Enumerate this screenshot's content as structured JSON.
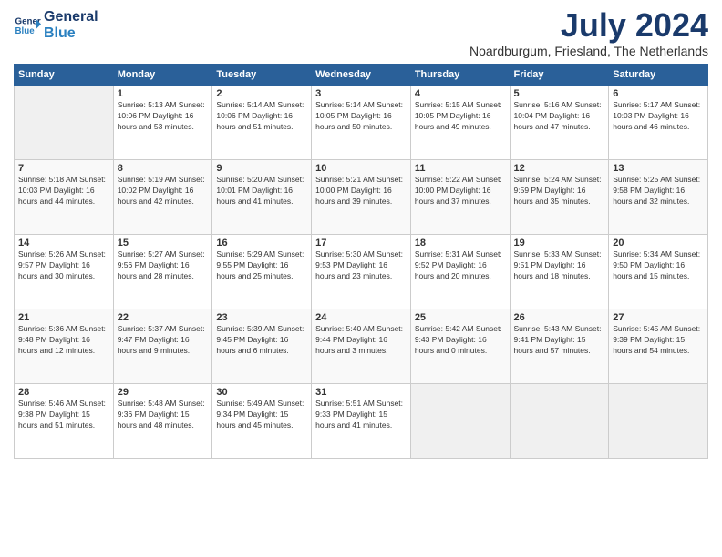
{
  "logo": {
    "line1": "General",
    "line2": "Blue"
  },
  "title": "July 2024",
  "location": "Noardburgum, Friesland, The Netherlands",
  "headers": [
    "Sunday",
    "Monday",
    "Tuesday",
    "Wednesday",
    "Thursday",
    "Friday",
    "Saturday"
  ],
  "weeks": [
    [
      {
        "day": "",
        "info": ""
      },
      {
        "day": "1",
        "info": "Sunrise: 5:13 AM\nSunset: 10:06 PM\nDaylight: 16 hours\nand 53 minutes."
      },
      {
        "day": "2",
        "info": "Sunrise: 5:14 AM\nSunset: 10:06 PM\nDaylight: 16 hours\nand 51 minutes."
      },
      {
        "day": "3",
        "info": "Sunrise: 5:14 AM\nSunset: 10:05 PM\nDaylight: 16 hours\nand 50 minutes."
      },
      {
        "day": "4",
        "info": "Sunrise: 5:15 AM\nSunset: 10:05 PM\nDaylight: 16 hours\nand 49 minutes."
      },
      {
        "day": "5",
        "info": "Sunrise: 5:16 AM\nSunset: 10:04 PM\nDaylight: 16 hours\nand 47 minutes."
      },
      {
        "day": "6",
        "info": "Sunrise: 5:17 AM\nSunset: 10:03 PM\nDaylight: 16 hours\nand 46 minutes."
      }
    ],
    [
      {
        "day": "7",
        "info": "Sunrise: 5:18 AM\nSunset: 10:03 PM\nDaylight: 16 hours\nand 44 minutes."
      },
      {
        "day": "8",
        "info": "Sunrise: 5:19 AM\nSunset: 10:02 PM\nDaylight: 16 hours\nand 42 minutes."
      },
      {
        "day": "9",
        "info": "Sunrise: 5:20 AM\nSunset: 10:01 PM\nDaylight: 16 hours\nand 41 minutes."
      },
      {
        "day": "10",
        "info": "Sunrise: 5:21 AM\nSunset: 10:00 PM\nDaylight: 16 hours\nand 39 minutes."
      },
      {
        "day": "11",
        "info": "Sunrise: 5:22 AM\nSunset: 10:00 PM\nDaylight: 16 hours\nand 37 minutes."
      },
      {
        "day": "12",
        "info": "Sunrise: 5:24 AM\nSunset: 9:59 PM\nDaylight: 16 hours\nand 35 minutes."
      },
      {
        "day": "13",
        "info": "Sunrise: 5:25 AM\nSunset: 9:58 PM\nDaylight: 16 hours\nand 32 minutes."
      }
    ],
    [
      {
        "day": "14",
        "info": "Sunrise: 5:26 AM\nSunset: 9:57 PM\nDaylight: 16 hours\nand 30 minutes."
      },
      {
        "day": "15",
        "info": "Sunrise: 5:27 AM\nSunset: 9:56 PM\nDaylight: 16 hours\nand 28 minutes."
      },
      {
        "day": "16",
        "info": "Sunrise: 5:29 AM\nSunset: 9:55 PM\nDaylight: 16 hours\nand 25 minutes."
      },
      {
        "day": "17",
        "info": "Sunrise: 5:30 AM\nSunset: 9:53 PM\nDaylight: 16 hours\nand 23 minutes."
      },
      {
        "day": "18",
        "info": "Sunrise: 5:31 AM\nSunset: 9:52 PM\nDaylight: 16 hours\nand 20 minutes."
      },
      {
        "day": "19",
        "info": "Sunrise: 5:33 AM\nSunset: 9:51 PM\nDaylight: 16 hours\nand 18 minutes."
      },
      {
        "day": "20",
        "info": "Sunrise: 5:34 AM\nSunset: 9:50 PM\nDaylight: 16 hours\nand 15 minutes."
      }
    ],
    [
      {
        "day": "21",
        "info": "Sunrise: 5:36 AM\nSunset: 9:48 PM\nDaylight: 16 hours\nand 12 minutes."
      },
      {
        "day": "22",
        "info": "Sunrise: 5:37 AM\nSunset: 9:47 PM\nDaylight: 16 hours\nand 9 minutes."
      },
      {
        "day": "23",
        "info": "Sunrise: 5:39 AM\nSunset: 9:45 PM\nDaylight: 16 hours\nand 6 minutes."
      },
      {
        "day": "24",
        "info": "Sunrise: 5:40 AM\nSunset: 9:44 PM\nDaylight: 16 hours\nand 3 minutes."
      },
      {
        "day": "25",
        "info": "Sunrise: 5:42 AM\nSunset: 9:43 PM\nDaylight: 16 hours\nand 0 minutes."
      },
      {
        "day": "26",
        "info": "Sunrise: 5:43 AM\nSunset: 9:41 PM\nDaylight: 15 hours\nand 57 minutes."
      },
      {
        "day": "27",
        "info": "Sunrise: 5:45 AM\nSunset: 9:39 PM\nDaylight: 15 hours\nand 54 minutes."
      }
    ],
    [
      {
        "day": "28",
        "info": "Sunrise: 5:46 AM\nSunset: 9:38 PM\nDaylight: 15 hours\nand 51 minutes."
      },
      {
        "day": "29",
        "info": "Sunrise: 5:48 AM\nSunset: 9:36 PM\nDaylight: 15 hours\nand 48 minutes."
      },
      {
        "day": "30",
        "info": "Sunrise: 5:49 AM\nSunset: 9:34 PM\nDaylight: 15 hours\nand 45 minutes."
      },
      {
        "day": "31",
        "info": "Sunrise: 5:51 AM\nSunset: 9:33 PM\nDaylight: 15 hours\nand 41 minutes."
      },
      {
        "day": "",
        "info": ""
      },
      {
        "day": "",
        "info": ""
      },
      {
        "day": "",
        "info": ""
      }
    ]
  ]
}
